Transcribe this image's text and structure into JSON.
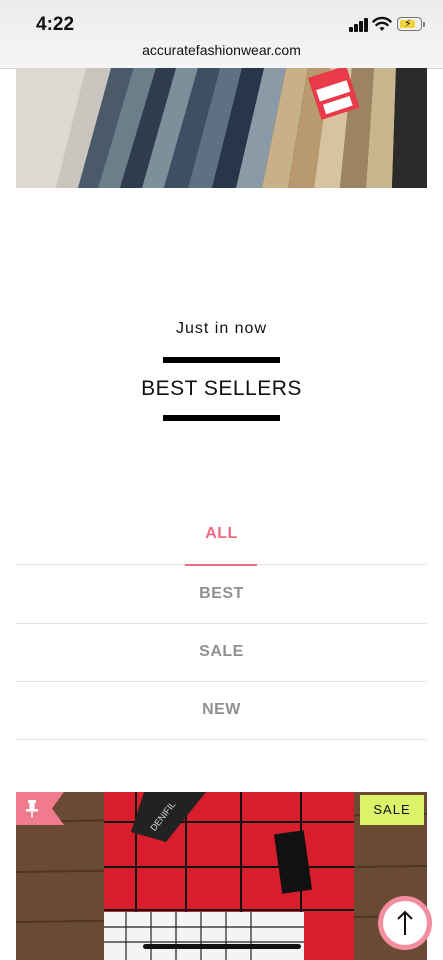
{
  "status_bar": {
    "time": "4:22",
    "url": "accuratefashionwear.com"
  },
  "banner": {
    "alt": "folded-jeans-display"
  },
  "section": {
    "kicker": "Just in now",
    "title": "BEST SELLERS"
  },
  "filters": {
    "tabs": [
      {
        "label": "ALL",
        "active": true
      },
      {
        "label": "BEST",
        "active": false
      },
      {
        "label": "SALE",
        "active": false
      },
      {
        "label": "NEW",
        "active": false
      }
    ]
  },
  "product": {
    "badge": "SALE",
    "brand_tag": "DENIFIL"
  },
  "colors": {
    "accent": "#ef6a82",
    "sale_badge": "#dcf268",
    "tab_inactive": "#909090"
  },
  "icons": {
    "pin": "pin-icon",
    "back_to_top": "arrow-up-icon"
  }
}
